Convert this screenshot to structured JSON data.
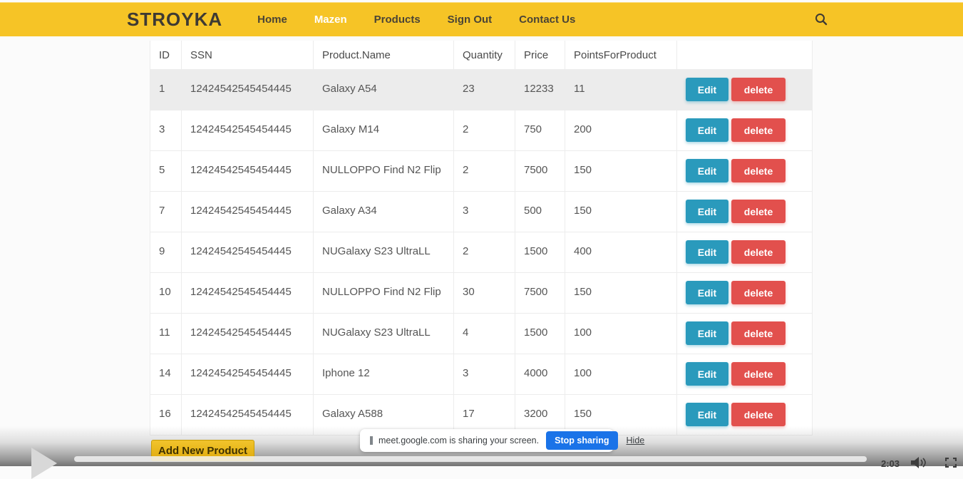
{
  "header": {
    "logo": "STROYKA",
    "nav": [
      {
        "label": "Home",
        "active": false
      },
      {
        "label": "Mazen",
        "active": true
      },
      {
        "label": "Products",
        "active": false
      },
      {
        "label": "Sign Out",
        "active": false
      },
      {
        "label": "Contact Us",
        "active": false
      }
    ],
    "colors": {
      "background": "#f6c426",
      "text": "#4a4436",
      "active_text": "#ffffff"
    }
  },
  "table": {
    "columns": [
      "ID",
      "SSN",
      "Product.Name",
      "Quantity",
      "Price",
      "PointsForProduct",
      ""
    ],
    "edit_label": "Edit",
    "delete_label": "delete",
    "colors": {
      "edit_button": "#2a9abc",
      "delete_button": "#e2504d",
      "highlight_row": "#ececec"
    },
    "rows": [
      {
        "id": "1",
        "ssn": "12424542545454445",
        "product_name": "Galaxy A54",
        "quantity": "23",
        "price": "12233",
        "points": "11",
        "highlighted": true
      },
      {
        "id": "3",
        "ssn": "12424542545454445",
        "product_name": "Galaxy M14",
        "quantity": "2",
        "price": "750",
        "points": "200",
        "highlighted": false
      },
      {
        "id": "5",
        "ssn": "12424542545454445",
        "product_name": "NULLOPPO Find N2 Flip",
        "quantity": "2",
        "price": "7500",
        "points": "150",
        "highlighted": false
      },
      {
        "id": "7",
        "ssn": "12424542545454445",
        "product_name": "Galaxy A34",
        "quantity": "3",
        "price": "500",
        "points": "150",
        "highlighted": false
      },
      {
        "id": "9",
        "ssn": "12424542545454445",
        "product_name": "NUGalaxy S23 UltraLL",
        "quantity": "2",
        "price": "1500",
        "points": "400",
        "highlighted": false
      },
      {
        "id": "10",
        "ssn": "12424542545454445",
        "product_name": "NULLOPPO Find N2 Flip",
        "quantity": "30",
        "price": "7500",
        "points": "150",
        "highlighted": false
      },
      {
        "id": "11",
        "ssn": "12424542545454445",
        "product_name": "NUGalaxy S23 UltraLL",
        "quantity": "4",
        "price": "1500",
        "points": "100",
        "highlighted": false
      },
      {
        "id": "14",
        "ssn": "12424542545454445",
        "product_name": "Iphone 12",
        "quantity": "3",
        "price": "4000",
        "points": "100",
        "highlighted": false
      },
      {
        "id": "16",
        "ssn": "12424542545454445",
        "product_name": "Galaxy A588",
        "quantity": "17",
        "price": "3200",
        "points": "150",
        "highlighted": false
      }
    ]
  },
  "actions": {
    "add_new_product_label": "Add New Product",
    "button_color": "#e3ac0d"
  },
  "share_banner": {
    "message": "meet.google.com is sharing your screen.",
    "stop_button_label": "Stop sharing",
    "hide_link_label": "Hide",
    "stop_button_color": "#1a73e8"
  },
  "video_player": {
    "time": "2:03"
  }
}
